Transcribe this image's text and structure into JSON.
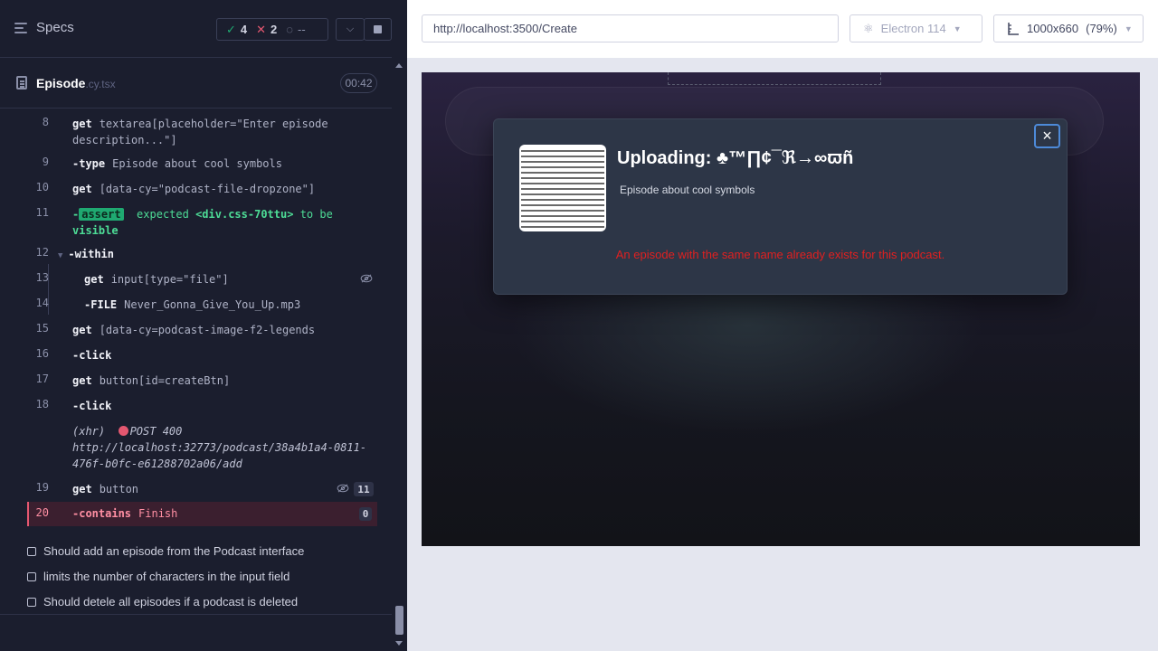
{
  "reporter": {
    "specs_label": "Specs",
    "stats": {
      "passed": "4",
      "failed": "2",
      "pending": "--"
    },
    "spec": {
      "name": "Episode",
      "ext": ".cy.tsx",
      "duration": "00:42"
    },
    "commands": [
      {
        "num": "8",
        "kw": "get",
        "arg": "textarea[placeholder=\"Enter episode",
        "arg2": "description...\"]"
      },
      {
        "num": "9",
        "kw": "-type",
        "arg": "Episode about cool symbols"
      },
      {
        "num": "10",
        "kw": "get",
        "arg": "[data-cy=\"podcast-file-dropzone\"]"
      },
      {
        "num": "11",
        "kw": "-",
        "badge": "assert",
        "text1": "expected",
        "text2": "<div.css-70ttu>",
        "text3": "to be",
        "text4": "visible"
      },
      {
        "num": "12",
        "kw": "-within"
      },
      {
        "num": "13",
        "kw": "get",
        "arg": "input[type=\"file\"]"
      },
      {
        "num": "14",
        "kw": "-FILE",
        "arg": "Never_Gonna_Give_You_Up.mp3"
      },
      {
        "num": "15",
        "kw": "get",
        "arg": "[data-cy=podcast-image-f2-legends"
      },
      {
        "num": "16",
        "kw": "-click"
      },
      {
        "num": "17",
        "kw": "get",
        "arg": "button[id=createBtn]"
      },
      {
        "num": "18",
        "kw": "-click"
      },
      {
        "num": "19",
        "kw": "get",
        "arg": "button",
        "count": "11"
      },
      {
        "num": "20",
        "kw": "-contains",
        "arg": "Finish",
        "count": "0"
      }
    ],
    "xhr": {
      "label": "(xhr)",
      "method": "POST 400",
      "url1": "http://localhost:32773/podcast/38a4b1a4-0811-",
      "url2": "476f-b0fc-e61288702a06/add"
    },
    "tests": [
      "Should add an episode from the Podcast interface",
      "limits the number of characters in the input field",
      "Should detele all episodes if a podcast is deleted"
    ]
  },
  "aut": {
    "url": "http://localhost:3500/Create",
    "browser": "Electron 114",
    "viewport": "1000x660",
    "zoom": "(79%)"
  },
  "modal": {
    "title": "Uploading: ♣™∏¢¯ℜ→∞ϖñ",
    "description": "Episode about cool symbols",
    "error": "An episode with the same name already exists for this podcast.",
    "close": "×"
  },
  "colors": {
    "passed": "#1fa971",
    "failed": "#e45770",
    "error_text": "#e02020",
    "focus_ring": "#4d8ad9"
  }
}
